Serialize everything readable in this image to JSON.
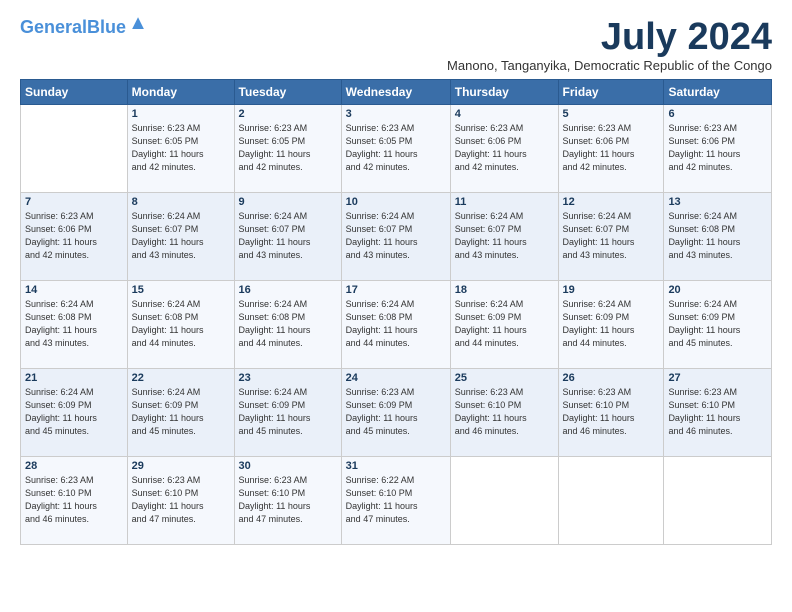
{
  "header": {
    "logo_line1": "General",
    "logo_line2": "Blue",
    "month_year": "July 2024",
    "location": "Manono, Tanganyika, Democratic Republic of the Congo"
  },
  "weekdays": [
    "Sunday",
    "Monday",
    "Tuesday",
    "Wednesday",
    "Thursday",
    "Friday",
    "Saturday"
  ],
  "weeks": [
    [
      {
        "day": "",
        "info": ""
      },
      {
        "day": "1",
        "info": "Sunrise: 6:23 AM\nSunset: 6:05 PM\nDaylight: 11 hours\nand 42 minutes."
      },
      {
        "day": "2",
        "info": "Sunrise: 6:23 AM\nSunset: 6:05 PM\nDaylight: 11 hours\nand 42 minutes."
      },
      {
        "day": "3",
        "info": "Sunrise: 6:23 AM\nSunset: 6:05 PM\nDaylight: 11 hours\nand 42 minutes."
      },
      {
        "day": "4",
        "info": "Sunrise: 6:23 AM\nSunset: 6:06 PM\nDaylight: 11 hours\nand 42 minutes."
      },
      {
        "day": "5",
        "info": "Sunrise: 6:23 AM\nSunset: 6:06 PM\nDaylight: 11 hours\nand 42 minutes."
      },
      {
        "day": "6",
        "info": "Sunrise: 6:23 AM\nSunset: 6:06 PM\nDaylight: 11 hours\nand 42 minutes."
      }
    ],
    [
      {
        "day": "7",
        "info": "Sunrise: 6:23 AM\nSunset: 6:06 PM\nDaylight: 11 hours\nand 42 minutes."
      },
      {
        "day": "8",
        "info": "Sunrise: 6:24 AM\nSunset: 6:07 PM\nDaylight: 11 hours\nand 43 minutes."
      },
      {
        "day": "9",
        "info": "Sunrise: 6:24 AM\nSunset: 6:07 PM\nDaylight: 11 hours\nand 43 minutes."
      },
      {
        "day": "10",
        "info": "Sunrise: 6:24 AM\nSunset: 6:07 PM\nDaylight: 11 hours\nand 43 minutes."
      },
      {
        "day": "11",
        "info": "Sunrise: 6:24 AM\nSunset: 6:07 PM\nDaylight: 11 hours\nand 43 minutes."
      },
      {
        "day": "12",
        "info": "Sunrise: 6:24 AM\nSunset: 6:07 PM\nDaylight: 11 hours\nand 43 minutes."
      },
      {
        "day": "13",
        "info": "Sunrise: 6:24 AM\nSunset: 6:08 PM\nDaylight: 11 hours\nand 43 minutes."
      }
    ],
    [
      {
        "day": "14",
        "info": "Sunrise: 6:24 AM\nSunset: 6:08 PM\nDaylight: 11 hours\nand 43 minutes."
      },
      {
        "day": "15",
        "info": "Sunrise: 6:24 AM\nSunset: 6:08 PM\nDaylight: 11 hours\nand 44 minutes."
      },
      {
        "day": "16",
        "info": "Sunrise: 6:24 AM\nSunset: 6:08 PM\nDaylight: 11 hours\nand 44 minutes."
      },
      {
        "day": "17",
        "info": "Sunrise: 6:24 AM\nSunset: 6:08 PM\nDaylight: 11 hours\nand 44 minutes."
      },
      {
        "day": "18",
        "info": "Sunrise: 6:24 AM\nSunset: 6:09 PM\nDaylight: 11 hours\nand 44 minutes."
      },
      {
        "day": "19",
        "info": "Sunrise: 6:24 AM\nSunset: 6:09 PM\nDaylight: 11 hours\nand 44 minutes."
      },
      {
        "day": "20",
        "info": "Sunrise: 6:24 AM\nSunset: 6:09 PM\nDaylight: 11 hours\nand 45 minutes."
      }
    ],
    [
      {
        "day": "21",
        "info": "Sunrise: 6:24 AM\nSunset: 6:09 PM\nDaylight: 11 hours\nand 45 minutes."
      },
      {
        "day": "22",
        "info": "Sunrise: 6:24 AM\nSunset: 6:09 PM\nDaylight: 11 hours\nand 45 minutes."
      },
      {
        "day": "23",
        "info": "Sunrise: 6:24 AM\nSunset: 6:09 PM\nDaylight: 11 hours\nand 45 minutes."
      },
      {
        "day": "24",
        "info": "Sunrise: 6:23 AM\nSunset: 6:09 PM\nDaylight: 11 hours\nand 45 minutes."
      },
      {
        "day": "25",
        "info": "Sunrise: 6:23 AM\nSunset: 6:10 PM\nDaylight: 11 hours\nand 46 minutes."
      },
      {
        "day": "26",
        "info": "Sunrise: 6:23 AM\nSunset: 6:10 PM\nDaylight: 11 hours\nand 46 minutes."
      },
      {
        "day": "27",
        "info": "Sunrise: 6:23 AM\nSunset: 6:10 PM\nDaylight: 11 hours\nand 46 minutes."
      }
    ],
    [
      {
        "day": "28",
        "info": "Sunrise: 6:23 AM\nSunset: 6:10 PM\nDaylight: 11 hours\nand 46 minutes."
      },
      {
        "day": "29",
        "info": "Sunrise: 6:23 AM\nSunset: 6:10 PM\nDaylight: 11 hours\nand 47 minutes."
      },
      {
        "day": "30",
        "info": "Sunrise: 6:23 AM\nSunset: 6:10 PM\nDaylight: 11 hours\nand 47 minutes."
      },
      {
        "day": "31",
        "info": "Sunrise: 6:22 AM\nSunset: 6:10 PM\nDaylight: 11 hours\nand 47 minutes."
      },
      {
        "day": "",
        "info": ""
      },
      {
        "day": "",
        "info": ""
      },
      {
        "day": "",
        "info": ""
      }
    ]
  ]
}
